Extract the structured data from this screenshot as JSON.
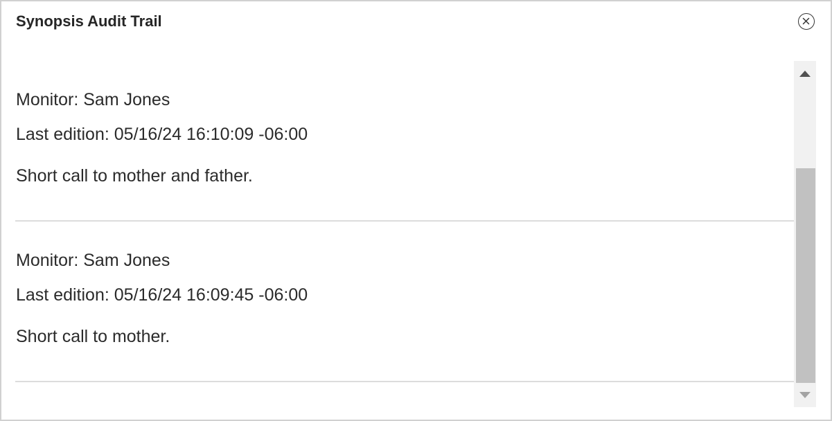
{
  "dialog": {
    "title": "Synopsis Audit Trail",
    "close_icon": "close-circle-icon"
  },
  "entries": [
    {
      "monitor": "Monitor: Sam Jones",
      "last_edition": "Last edition: 05/16/24 16:10:09 -06:00",
      "note": "Short call to mother and father."
    },
    {
      "monitor": "Monitor: Sam Jones",
      "last_edition": "Last edition: 05/16/24 16:09:45 -06:00",
      "note": "Short call to mother."
    }
  ],
  "scrollbar": {
    "up_icon": "arrow-up-icon",
    "down_icon": "arrow-down-icon"
  },
  "colors": {
    "border": "#d0d0d0",
    "divider": "#dcdcdc",
    "scroll_track": "#f1f1f1",
    "scroll_thumb": "#c1c1c1",
    "text": "#2b2b2b"
  }
}
